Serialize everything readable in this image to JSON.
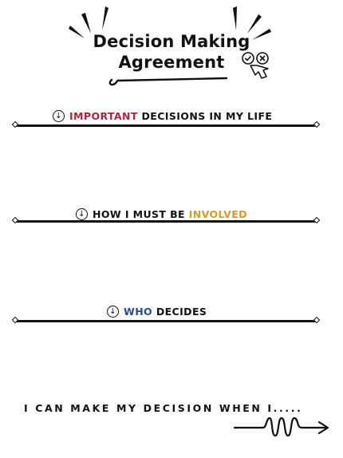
{
  "header": {
    "title_line1": "Decision Making",
    "title_line2": "Agreement",
    "icon": "decision-hand-icon"
  },
  "sections": [
    {
      "icon": "circle-down-arrow-icon",
      "accent": "Important",
      "rest": " decisions in my life",
      "accent_color": "#b0243a"
    },
    {
      "icon": "circle-down-arrow-icon",
      "lead": "How I must be ",
      "accent": "involved",
      "accent_color": "#d49a2a"
    },
    {
      "icon": "circle-down-arrow-icon",
      "accent": "Who",
      "rest": " decides",
      "accent_color": "#274e8c"
    }
  ],
  "footer": {
    "text": "I can make my decision when I.....",
    "icon": "squiggle-arrow-icon"
  }
}
